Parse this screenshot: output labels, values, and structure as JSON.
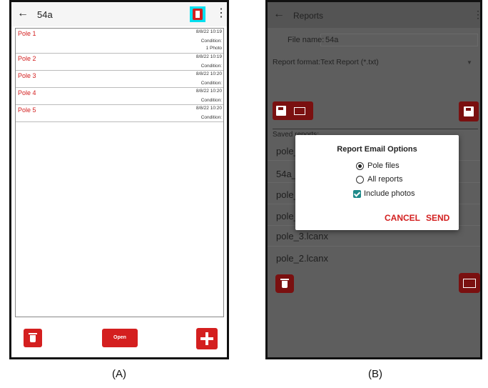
{
  "panel_a": {
    "caption": "(A)",
    "appbar": {
      "back_glyph": "←",
      "title": "54a",
      "more_glyph": "⋮"
    },
    "poles": [
      {
        "name": "Pole 1",
        "date": "8/8/22 10:19",
        "condition": "Condition:",
        "photos": "1 Photo"
      },
      {
        "name": "Pole 2",
        "date": "8/8/22 10:19",
        "condition": "Condition:"
      },
      {
        "name": "Pole 3",
        "date": "8/8/22 10:20",
        "condition": "Condition:"
      },
      {
        "name": "Pole 4",
        "date": "8/8/22 10:20",
        "condition": "Condition:"
      },
      {
        "name": "Pole 5",
        "date": "8/8/22 10:20",
        "condition": "Condition:"
      }
    ],
    "open_label": "Open",
    "colors": {
      "accent": "#d41f1f",
      "highlight": "#00e0f0"
    }
  },
  "panel_b": {
    "caption": "(B)",
    "appbar": {
      "back_glyph": "←",
      "title": "Reports",
      "more_glyph": "⋮"
    },
    "file_name_label": "File name:",
    "file_name_value": "54a",
    "report_format": "Report format:Text Report (*.txt)",
    "saved_reports_label": "Saved reports:",
    "saved_items": [
      "pole_",
      "54a_",
      "pole_",
      "pole_",
      "pole_3.lcanx",
      "pole_2.lcanx"
    ],
    "dialog": {
      "title": "Report Email Options",
      "option_pole_files": "Pole files",
      "option_all_reports": "All reports",
      "option_include_photos": "Include photos",
      "cancel": "CANCEL",
      "send": "SEND"
    },
    "colors": {
      "dim_accent": "#7a1010",
      "checkbox": "#1f8a8a",
      "action": "#d32020"
    }
  }
}
